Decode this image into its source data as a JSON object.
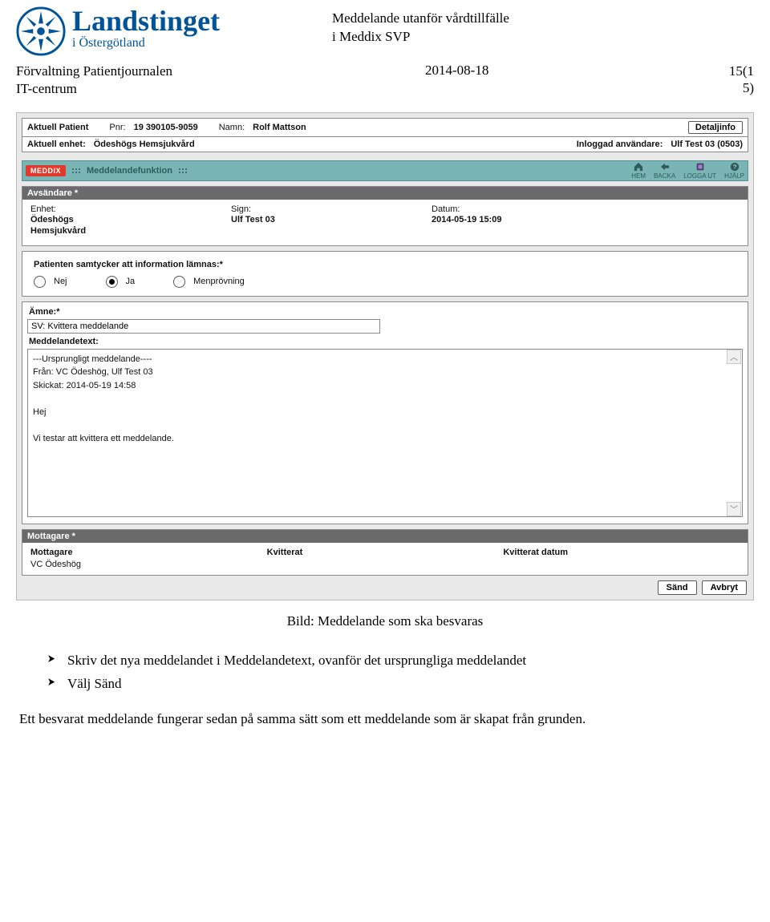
{
  "doc": {
    "logo_line1": "Landstinget",
    "logo_line2": "i Östergötland",
    "title_line1": "Meddelande utanför vårdtillfälle",
    "title_line2": "i Meddix SVP",
    "dept_line1": "Förvaltning Patientjournalen",
    "dept_line2": "IT-centrum",
    "date": "2014-08-18",
    "page": "15(1\n5)"
  },
  "patient": {
    "lbl_patient": "Aktuell Patient",
    "lbl_pnr": "Pnr:",
    "pnr": "19 390105-9059",
    "lbl_name": "Namn:",
    "name": "Rolf Mattson",
    "detail_btn": "Detaljinfo",
    "lbl_unit": "Aktuell enhet:",
    "unit": "Ödeshögs Hemsjukvård",
    "lbl_user": "Inloggad användare:",
    "user": "Ulf Test 03 (0503)"
  },
  "toolbar": {
    "brand": "MEDDIX",
    "title": "Meddelandefunktion",
    "items": {
      "home": "HEM",
      "back": "BACKA",
      "logout": "LOGGA UT",
      "help": "HJÄLP"
    }
  },
  "sender": {
    "section": "Avsändare *",
    "lbl_unit": "Enhet:",
    "unit": "Ödeshögs\nHemsjukvård",
    "lbl_sign": "Sign:",
    "sign": "Ulf Test 03",
    "lbl_date": "Datum:",
    "date": "2014-05-19 15:09"
  },
  "consent": {
    "label": "Patienten samtycker att information lämnas:*",
    "opt_no": "Nej",
    "opt_yes": "Ja",
    "opt_men": "Menprövning"
  },
  "subject": {
    "lbl": "Ämne:*",
    "value": "SV: Kvittera meddelande",
    "body_lbl": "Meddelandetext:",
    "body": "---Ursprungligt meddelande----\nFrån: VC Ödeshög, Ulf Test 03\nSkickat: 2014-05-19 14:58\n\nHej\n\nVi testar att kvittera ett meddelande."
  },
  "recipients": {
    "section": "Mottagare *",
    "col1": "Mottagare",
    "col2": "Kvitterat",
    "col3": "Kvitterat datum",
    "rows": [
      {
        "mottagare": "VC Ödeshög",
        "kvitterat": "",
        "datum": ""
      }
    ]
  },
  "buttons": {
    "send": "Sänd",
    "cancel": "Avbryt"
  },
  "caption": "Bild: Meddelande som ska besvaras",
  "bullets": {
    "b1": "Skriv det nya meddelandet i Meddelandetext, ovanför det ursprungliga meddelandet",
    "b2": "Välj Sänd"
  },
  "para": "Ett besvarat meddelande fungerar sedan på samma sätt som ett meddelande som är skapat från grunden."
}
